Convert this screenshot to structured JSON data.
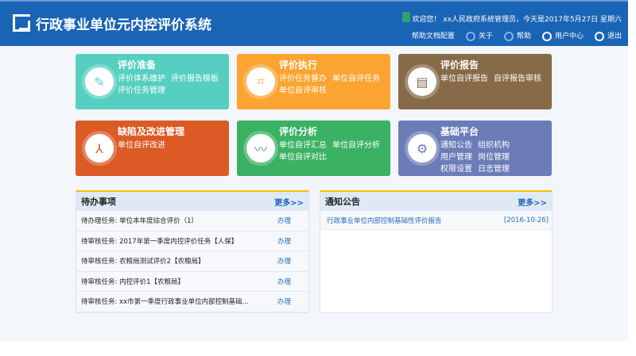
{
  "header": {
    "title": "行政事业单位元内控评价系统",
    "welcome": "欢迎您！ xx人民政府系统管理员，今天是2017年5月27日 星期六",
    "links": [
      "帮助文档配置",
      "关于",
      "帮助",
      "用户中心",
      "退出"
    ]
  },
  "cards": [
    {
      "title": "评价准备",
      "items": [
        "评价体系维护",
        "评价报告模板",
        "评价任务管理"
      ],
      "color": "#56cfc0",
      "icon": "✎"
    },
    {
      "title": "评价执行",
      "items": [
        "评价任务督办",
        "单位自评任务",
        "单位自评审核"
      ],
      "color": "#fca431",
      "icon": "⌗"
    },
    {
      "title": "评价报告",
      "items": [
        "单位自评报告",
        "自评报告审核"
      ],
      "color": "#876a47",
      "icon": "▤"
    },
    {
      "title": "缺陷及改进管理",
      "items": [
        "单位自评改进"
      ],
      "color": "#dc5a26",
      "icon": "⅄"
    },
    {
      "title": "评价分析",
      "items": [
        "单位自评汇总",
        "单位自评分析",
        "单位自评对比"
      ],
      "color": "#3bb163",
      "icon": "〰"
    },
    {
      "title": "基础平台",
      "items": [
        "通知公告",
        "组织机构",
        "用户管理",
        "岗位管理",
        "权限设置",
        "日志管理"
      ],
      "color": "#6c7cb8",
      "icon": "⚙"
    }
  ],
  "todo": {
    "title": "待办事项",
    "more": "更多>>",
    "action": "办理",
    "rows": [
      "待办理任务: 单位本年度综合评价（1）",
      "待审核任务: 2017年第一季度内控评价任务【人保】",
      "待审核任务: 农粮局测试评价2【农粮局】",
      "待审核任务: 内控评价1【农粮局】",
      "待审核任务: xx市第一季度行政事业单位内部控制基础..."
    ]
  },
  "notice": {
    "title": "通知公告",
    "more": "更多>>",
    "rows": [
      {
        "text": "行政事业单位内部控制基础性评价报告",
        "date": "[2016-10-26]"
      }
    ]
  }
}
